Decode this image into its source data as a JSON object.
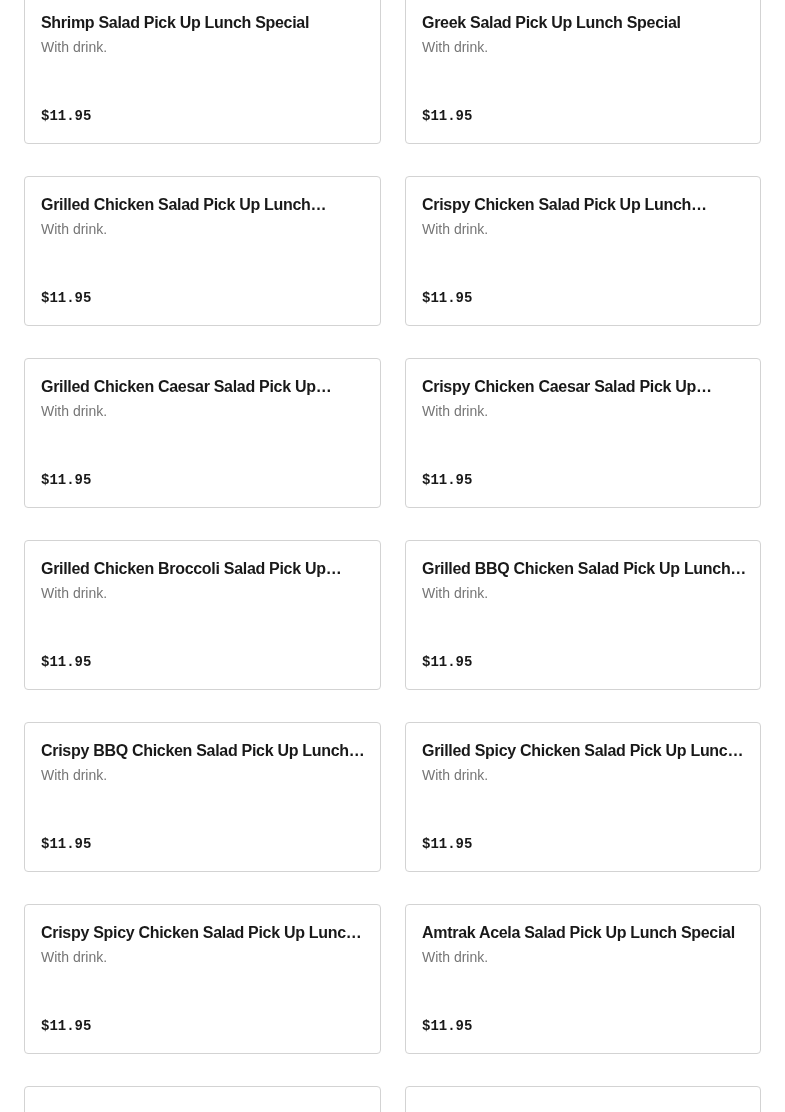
{
  "items": [
    {
      "name": "Shrimp Salad Pick Up Lunch Special",
      "description": "With drink.",
      "price": "$11.95"
    },
    {
      "name": "Greek Salad Pick Up Lunch Special",
      "description": "With drink.",
      "price": "$11.95"
    },
    {
      "name": "Grilled Chicken Salad Pick Up Lunch…",
      "description": "With drink.",
      "price": "$11.95"
    },
    {
      "name": "Crispy Chicken Salad Pick Up Lunch…",
      "description": "With drink.",
      "price": "$11.95"
    },
    {
      "name": "Grilled Chicken Caesar Salad Pick Up…",
      "description": "With drink.",
      "price": "$11.95"
    },
    {
      "name": "Crispy Chicken Caesar Salad Pick Up…",
      "description": "With drink.",
      "price": "$11.95"
    },
    {
      "name": "Grilled Chicken Broccoli Salad Pick Up…",
      "description": "With drink.",
      "price": "$11.95"
    },
    {
      "name": "Grilled BBQ Chicken Salad Pick Up Lunch…",
      "description": "With drink.",
      "price": "$11.95"
    },
    {
      "name": "Crispy BBQ Chicken Salad Pick Up Lunch…",
      "description": "With drink.",
      "price": "$11.95"
    },
    {
      "name": "Grilled Spicy Chicken Salad Pick Up Lunc…",
      "description": "With drink.",
      "price": "$11.95"
    },
    {
      "name": "Crispy Spicy Chicken Salad Pick Up Lunc…",
      "description": "With drink.",
      "price": "$11.95"
    },
    {
      "name": "Amtrak Acela Salad Pick Up Lunch Special",
      "description": "With drink.",
      "price": "$11.95"
    }
  ]
}
